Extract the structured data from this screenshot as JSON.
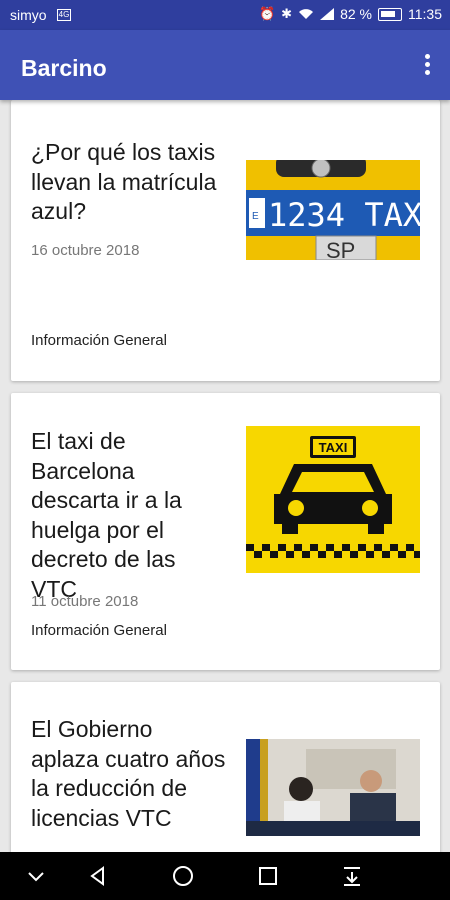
{
  "status_bar": {
    "carrier": "simyo",
    "battery": "82 %",
    "time": "11:35"
  },
  "app_bar": {
    "title": "Barcino"
  },
  "articles": [
    {
      "title": "¿Por qué los taxis llevan la matrícula azul?",
      "date": "16 octubre 2018",
      "category": "Información General",
      "plate_text": "1234 TAX",
      "plate_region": "SP"
    },
    {
      "title": "El taxi de Barcelona descarta ir a la huelga por el decreto de las VTC",
      "date": "11 octubre 2018",
      "category": "Información General",
      "sign_text": "TAXI"
    },
    {
      "title": "El Gobierno aplaza cuatro años la reducción de licencias VTC"
    }
  ],
  "colors": {
    "status_bar": "#2f3e9e",
    "app_bar": "#3f51b5",
    "taxi_yellow": "#f7d700"
  }
}
